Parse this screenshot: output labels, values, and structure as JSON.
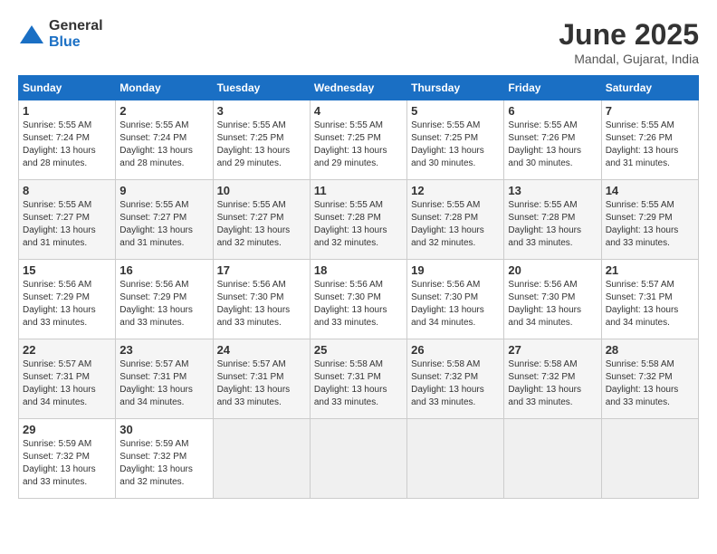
{
  "logo": {
    "general": "General",
    "blue": "Blue"
  },
  "title": {
    "month": "June 2025",
    "location": "Mandal, Gujarat, India"
  },
  "headers": [
    "Sunday",
    "Monday",
    "Tuesday",
    "Wednesday",
    "Thursday",
    "Friday",
    "Saturday"
  ],
  "days": [
    {
      "num": "",
      "info": ""
    },
    {
      "num": "1",
      "info": "Sunrise: 5:55 AM\nSunset: 7:24 PM\nDaylight: 13 hours\nand 28 minutes."
    },
    {
      "num": "2",
      "info": "Sunrise: 5:55 AM\nSunset: 7:24 PM\nDaylight: 13 hours\nand 28 minutes."
    },
    {
      "num": "3",
      "info": "Sunrise: 5:55 AM\nSunset: 7:25 PM\nDaylight: 13 hours\nand 29 minutes."
    },
    {
      "num": "4",
      "info": "Sunrise: 5:55 AM\nSunset: 7:25 PM\nDaylight: 13 hours\nand 29 minutes."
    },
    {
      "num": "5",
      "info": "Sunrise: 5:55 AM\nSunset: 7:25 PM\nDaylight: 13 hours\nand 30 minutes."
    },
    {
      "num": "6",
      "info": "Sunrise: 5:55 AM\nSunset: 7:26 PM\nDaylight: 13 hours\nand 30 minutes."
    },
    {
      "num": "7",
      "info": "Sunrise: 5:55 AM\nSunset: 7:26 PM\nDaylight: 13 hours\nand 31 minutes."
    },
    {
      "num": "8",
      "info": "Sunrise: 5:55 AM\nSunset: 7:27 PM\nDaylight: 13 hours\nand 31 minutes."
    },
    {
      "num": "9",
      "info": "Sunrise: 5:55 AM\nSunset: 7:27 PM\nDaylight: 13 hours\nand 31 minutes."
    },
    {
      "num": "10",
      "info": "Sunrise: 5:55 AM\nSunset: 7:27 PM\nDaylight: 13 hours\nand 32 minutes."
    },
    {
      "num": "11",
      "info": "Sunrise: 5:55 AM\nSunset: 7:28 PM\nDaylight: 13 hours\nand 32 minutes."
    },
    {
      "num": "12",
      "info": "Sunrise: 5:55 AM\nSunset: 7:28 PM\nDaylight: 13 hours\nand 32 minutes."
    },
    {
      "num": "13",
      "info": "Sunrise: 5:55 AM\nSunset: 7:28 PM\nDaylight: 13 hours\nand 33 minutes."
    },
    {
      "num": "14",
      "info": "Sunrise: 5:55 AM\nSunset: 7:29 PM\nDaylight: 13 hours\nand 33 minutes."
    },
    {
      "num": "15",
      "info": "Sunrise: 5:56 AM\nSunset: 7:29 PM\nDaylight: 13 hours\nand 33 minutes."
    },
    {
      "num": "16",
      "info": "Sunrise: 5:56 AM\nSunset: 7:29 PM\nDaylight: 13 hours\nand 33 minutes."
    },
    {
      "num": "17",
      "info": "Sunrise: 5:56 AM\nSunset: 7:30 PM\nDaylight: 13 hours\nand 33 minutes."
    },
    {
      "num": "18",
      "info": "Sunrise: 5:56 AM\nSunset: 7:30 PM\nDaylight: 13 hours\nand 33 minutes."
    },
    {
      "num": "19",
      "info": "Sunrise: 5:56 AM\nSunset: 7:30 PM\nDaylight: 13 hours\nand 34 minutes."
    },
    {
      "num": "20",
      "info": "Sunrise: 5:56 AM\nSunset: 7:30 PM\nDaylight: 13 hours\nand 34 minutes."
    },
    {
      "num": "21",
      "info": "Sunrise: 5:57 AM\nSunset: 7:31 PM\nDaylight: 13 hours\nand 34 minutes."
    },
    {
      "num": "22",
      "info": "Sunrise: 5:57 AM\nSunset: 7:31 PM\nDaylight: 13 hours\nand 34 minutes."
    },
    {
      "num": "23",
      "info": "Sunrise: 5:57 AM\nSunset: 7:31 PM\nDaylight: 13 hours\nand 34 minutes."
    },
    {
      "num": "24",
      "info": "Sunrise: 5:57 AM\nSunset: 7:31 PM\nDaylight: 13 hours\nand 33 minutes."
    },
    {
      "num": "25",
      "info": "Sunrise: 5:58 AM\nSunset: 7:31 PM\nDaylight: 13 hours\nand 33 minutes."
    },
    {
      "num": "26",
      "info": "Sunrise: 5:58 AM\nSunset: 7:32 PM\nDaylight: 13 hours\nand 33 minutes."
    },
    {
      "num": "27",
      "info": "Sunrise: 5:58 AM\nSunset: 7:32 PM\nDaylight: 13 hours\nand 33 minutes."
    },
    {
      "num": "28",
      "info": "Sunrise: 5:58 AM\nSunset: 7:32 PM\nDaylight: 13 hours\nand 33 minutes."
    },
    {
      "num": "29",
      "info": "Sunrise: 5:59 AM\nSunset: 7:32 PM\nDaylight: 13 hours\nand 33 minutes."
    },
    {
      "num": "30",
      "info": "Sunrise: 5:59 AM\nSunset: 7:32 PM\nDaylight: 13 hours\nand 32 minutes."
    },
    {
      "num": "",
      "info": ""
    },
    {
      "num": "",
      "info": ""
    },
    {
      "num": "",
      "info": ""
    },
    {
      "num": "",
      "info": ""
    },
    {
      "num": "",
      "info": ""
    }
  ]
}
